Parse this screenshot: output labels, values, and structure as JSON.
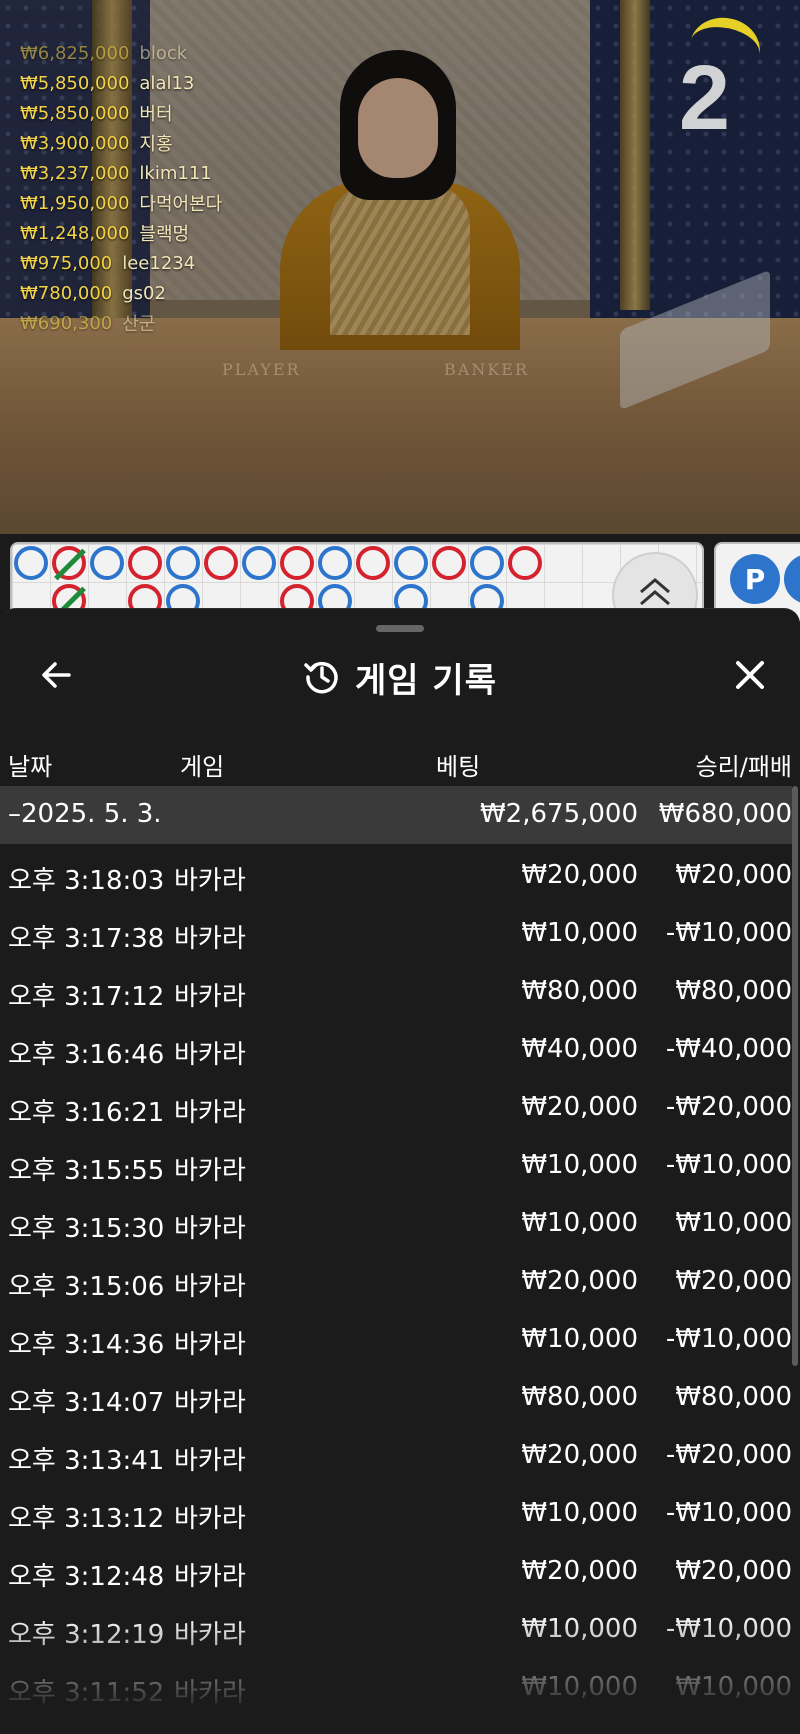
{
  "video": {
    "round_number": "2",
    "table_labels": {
      "player": "PLAYER",
      "banker": "BANKER"
    },
    "winners": [
      {
        "amount": "₩6,825,000",
        "name": "block"
      },
      {
        "amount": "₩5,850,000",
        "name": "alal13"
      },
      {
        "amount": "₩5,850,000",
        "name": "버터"
      },
      {
        "amount": "₩3,900,000",
        "name": "지홍"
      },
      {
        "amount": "₩3,237,000",
        "name": "lkim111"
      },
      {
        "amount": "₩1,950,000",
        "name": "다먹어본다"
      },
      {
        "amount": "₩1,248,000",
        "name": "블랙멍"
      },
      {
        "amount": "₩975,000",
        "name": "lee1234"
      },
      {
        "amount": "₩780,000",
        "name": "gs02"
      },
      {
        "amount": "₩690,300",
        "name": "산군"
      }
    ]
  },
  "roadmap": {
    "beads_row1": [
      "blue",
      "red",
      "blue",
      "red",
      "blue",
      "red",
      "blue",
      "red",
      "blue",
      "red",
      "blue",
      "red",
      "blue",
      "red"
    ],
    "beads_row2": [
      "",
      "red",
      "",
      "red",
      "blue",
      "",
      "",
      "red",
      "blue",
      "",
      "blue",
      "",
      "blue",
      ""
    ],
    "side_chip_label": "P",
    "toggle_icon": "chevron-up-double-icon"
  },
  "panel": {
    "title": "게임 기록",
    "title_icon": "history-icon",
    "back_icon": "arrow-left-icon",
    "close_icon": "close-icon",
    "columns": {
      "date": "날짜",
      "game": "게임",
      "bet": "베팅",
      "win_loss": "승리/패배"
    },
    "summary": {
      "date": "–2025. 5. 3.",
      "bet": "₩2,675,000",
      "win_loss": "₩680,000"
    },
    "rows": [
      {
        "time": "오후 3:18:03",
        "game": "바카라",
        "bet": "₩20,000",
        "win_loss": "₩20,000"
      },
      {
        "time": "오후 3:17:38",
        "game": "바카라",
        "bet": "₩10,000",
        "win_loss": "-₩10,000"
      },
      {
        "time": "오후 3:17:12",
        "game": "바카라",
        "bet": "₩80,000",
        "win_loss": "₩80,000"
      },
      {
        "time": "오후 3:16:46",
        "game": "바카라",
        "bet": "₩40,000",
        "win_loss": "-₩40,000"
      },
      {
        "time": "오후 3:16:21",
        "game": "바카라",
        "bet": "₩20,000",
        "win_loss": "-₩20,000"
      },
      {
        "time": "오후 3:15:55",
        "game": "바카라",
        "bet": "₩10,000",
        "win_loss": "-₩10,000"
      },
      {
        "time": "오후 3:15:30",
        "game": "바카라",
        "bet": "₩10,000",
        "win_loss": "₩10,000"
      },
      {
        "time": "오후 3:15:06",
        "game": "바카라",
        "bet": "₩20,000",
        "win_loss": "₩20,000"
      },
      {
        "time": "오후 3:14:36",
        "game": "바카라",
        "bet": "₩10,000",
        "win_loss": "-₩10,000"
      },
      {
        "time": "오후 3:14:07",
        "game": "바카라",
        "bet": "₩80,000",
        "win_loss": "₩80,000"
      },
      {
        "time": "오후 3:13:41",
        "game": "바카라",
        "bet": "₩20,000",
        "win_loss": "-₩20,000"
      },
      {
        "time": "오후 3:13:12",
        "game": "바카라",
        "bet": "₩10,000",
        "win_loss": "-₩10,000"
      },
      {
        "time": "오후 3:12:48",
        "game": "바카라",
        "bet": "₩20,000",
        "win_loss": "₩20,000"
      },
      {
        "time": "오후 3:12:19",
        "game": "바카라",
        "bet": "₩10,000",
        "win_loss": "-₩10,000"
      },
      {
        "time": "오후 3:11:52",
        "game": "바카라",
        "bet": "₩10,000",
        "win_loss": "₩10,000"
      }
    ],
    "colors": {
      "panel_bg": "#1b1b1b",
      "summary_bg": "#3a3a3a",
      "winner_gold": "#f2d34a"
    }
  }
}
